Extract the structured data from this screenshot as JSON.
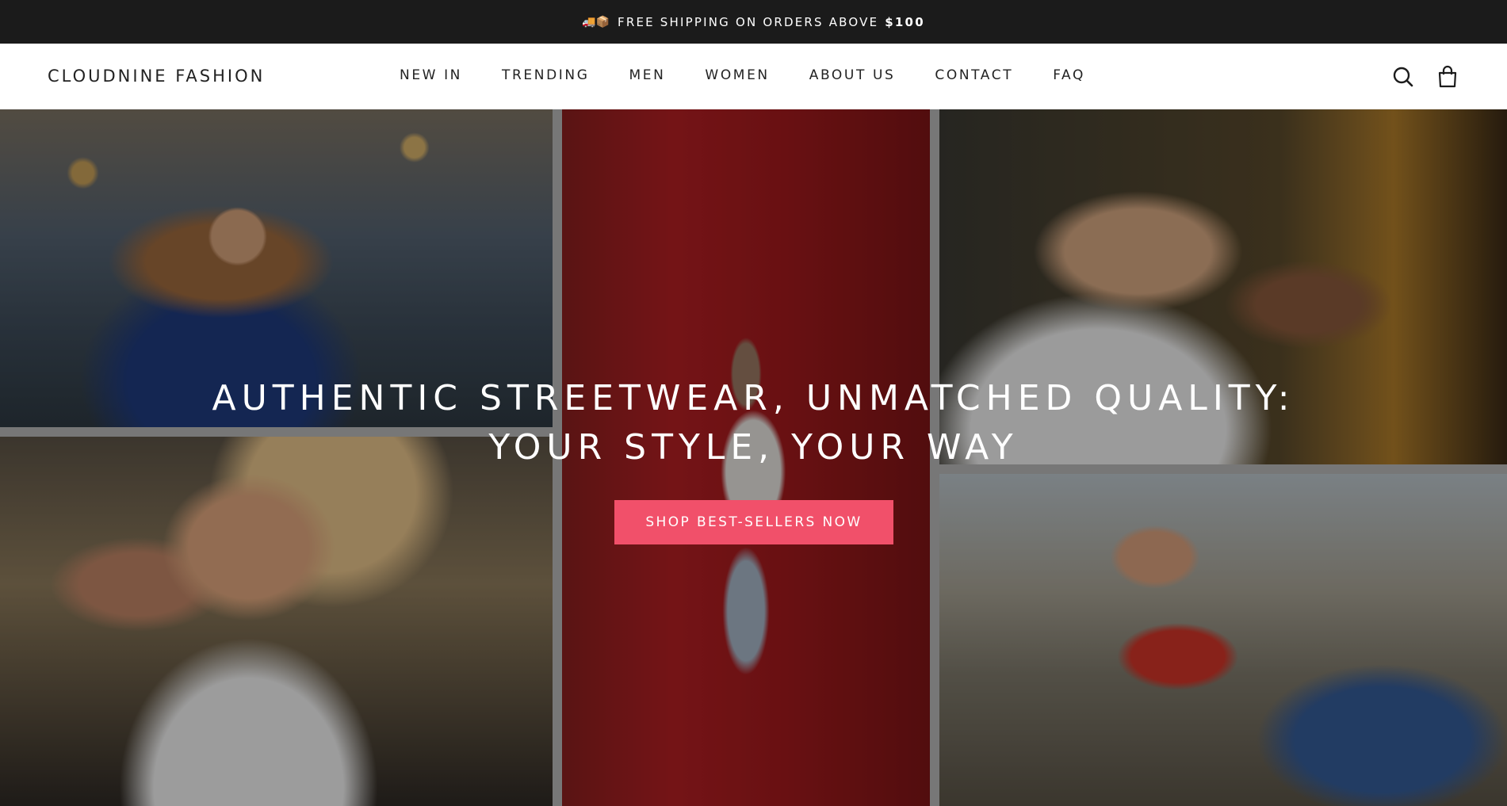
{
  "announcement": {
    "emoji": "🚚📦",
    "text": "FREE SHIPPING ON ORDERS ABOVE",
    "amount": "$100"
  },
  "header": {
    "logo": "CLOUDNINE FASHION",
    "nav": [
      "NEW IN",
      "TRENDING",
      "MEN",
      "WOMEN",
      "ABOUT US",
      "CONTACT",
      "FAQ"
    ],
    "icons": [
      "search-icon",
      "bag-icon"
    ]
  },
  "hero": {
    "headline_line1": "AUTHENTIC STREETWEAR, UNMATCHED QUALITY:",
    "headline_line2": "YOUR STYLE, YOUR WAY",
    "cta_label": "SHOP BEST-SELLERS NOW",
    "cta_color": "#f1506a"
  }
}
